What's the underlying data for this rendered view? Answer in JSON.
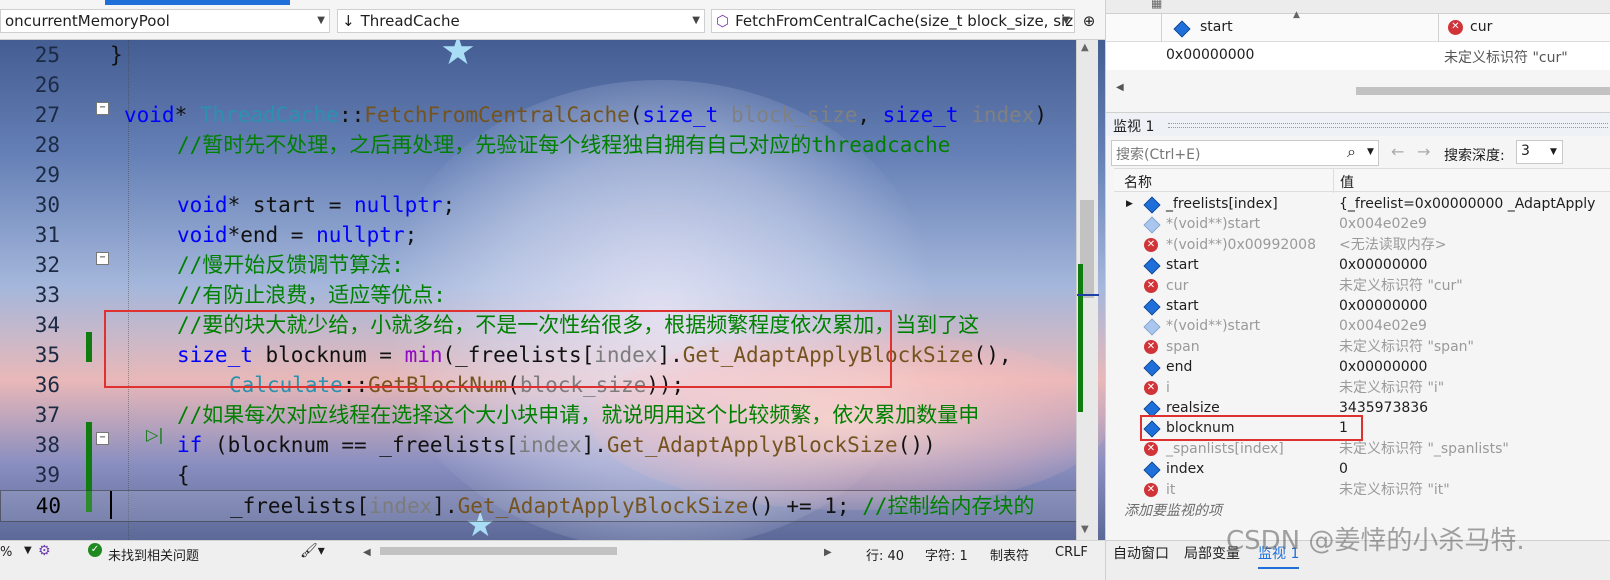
{
  "nav": {
    "project": "oncurrentMemoryPool",
    "class": "ThreadCache",
    "member": "FetchFromCentralCache(size_t block_size, size_"
  },
  "code_lines": [
    {
      "n": "25",
      "text": "}"
    },
    {
      "n": "26",
      "text": ""
    },
    {
      "n": "27",
      "text": "void* ThreadCache::FetchFromCentralCache(size_t block_size, size_t index)"
    },
    {
      "n": "28",
      "text": "//暂时先不处理，之后再处理，先验证每个线程独自拥有自己对应的threadcache"
    },
    {
      "n": "29",
      "text": ""
    },
    {
      "n": "30",
      "text": "void* start = nullptr;"
    },
    {
      "n": "31",
      "text": "void*end = nullptr;"
    },
    {
      "n": "32",
      "text": "//慢开始反馈调节算法:"
    },
    {
      "n": "33",
      "text": "//有防止浪费，适应等优点:"
    },
    {
      "n": "34",
      "text": "//要的块大就少给，小就多给，不是一次性给很多，根据频繁程度依次累加，当到了这"
    },
    {
      "n": "35",
      "text": "size_t blocknum = min(_freelists[index].Get_AdaptApplyBlockSize(),"
    },
    {
      "n": "36",
      "text": "Calculate::GetBlockNum(block_size));"
    },
    {
      "n": "37",
      "text": "//如果每次对应线程在选择这个大小块申请，就说明用这个比较频繁，依次累加数量申"
    },
    {
      "n": "38",
      "text": "if (blocknum == _freelists[index].Get_AdaptApplyBlockSize())"
    },
    {
      "n": "39",
      "text": "{"
    },
    {
      "n": "40",
      "text": "_freelists[index].Get_AdaptApplyBlockSize() += 1; //控制给内存块的"
    }
  ],
  "status": {
    "zoom": "%",
    "issues": "未找到相关问题",
    "line": "行: 40",
    "char": "字符: 1",
    "tabs": "制表符",
    "eol": "CRLF"
  },
  "autos": {
    "col1": "start",
    "col2": "cur",
    "val1": "0x00000000",
    "val2": "未定义标识符 \"cur\""
  },
  "watch": {
    "title": "监视 1",
    "search_placeholder": "搜索(Ctrl+E)",
    "depth_label": "搜索深度:",
    "depth_value": "3",
    "col_name": "名称",
    "col_value": "值",
    "add_item": "添加要监视的项",
    "rows": [
      {
        "name": "_freelists[index]",
        "value": "{_freelist=0x00000000 _AdaptApply",
        "icon": "cube",
        "expand": true
      },
      {
        "name": "*(void**)start",
        "value": "0x004e02e9",
        "icon": "cube-faded",
        "grey": true
      },
      {
        "name": "*(void**)0x00992008",
        "value": "<无法读取内存>",
        "icon": "error",
        "grey": true
      },
      {
        "name": "start",
        "value": "0x00000000",
        "icon": "cube"
      },
      {
        "name": "cur",
        "value": "未定义标识符 \"cur\"",
        "icon": "error",
        "grey": true
      },
      {
        "name": "start",
        "value": "0x00000000",
        "icon": "cube"
      },
      {
        "name": "*(void**)start",
        "value": "0x004e02e9",
        "icon": "cube-faded",
        "grey": true
      },
      {
        "name": "span",
        "value": "未定义标识符 \"span\"",
        "icon": "error",
        "grey": true
      },
      {
        "name": "end",
        "value": "0x00000000",
        "icon": "cube"
      },
      {
        "name": "i",
        "value": "未定义标识符 \"i\"",
        "icon": "error",
        "grey": true
      },
      {
        "name": "realsize",
        "value": "3435973836",
        "icon": "cube"
      },
      {
        "name": "blocknum",
        "value": "1",
        "icon": "cube",
        "highlight": true
      },
      {
        "name": "_spanlists[index]",
        "value": "未定义标识符 \"_spanlists\"",
        "icon": "error",
        "grey": true
      },
      {
        "name": "index",
        "value": "0",
        "icon": "cube"
      },
      {
        "name": "it",
        "value": "未定义标识符 \"it\"",
        "icon": "error",
        "grey": true
      }
    ]
  },
  "bottom_tabs": [
    "自动窗口",
    "局部变量",
    "监视 1"
  ],
  "watermark": "CSDN @姜悻的小杀马特.",
  "colors": {
    "highlight_box": "#e03131",
    "change_bar": "#107c10",
    "active_tab": "#1e6fd9"
  }
}
